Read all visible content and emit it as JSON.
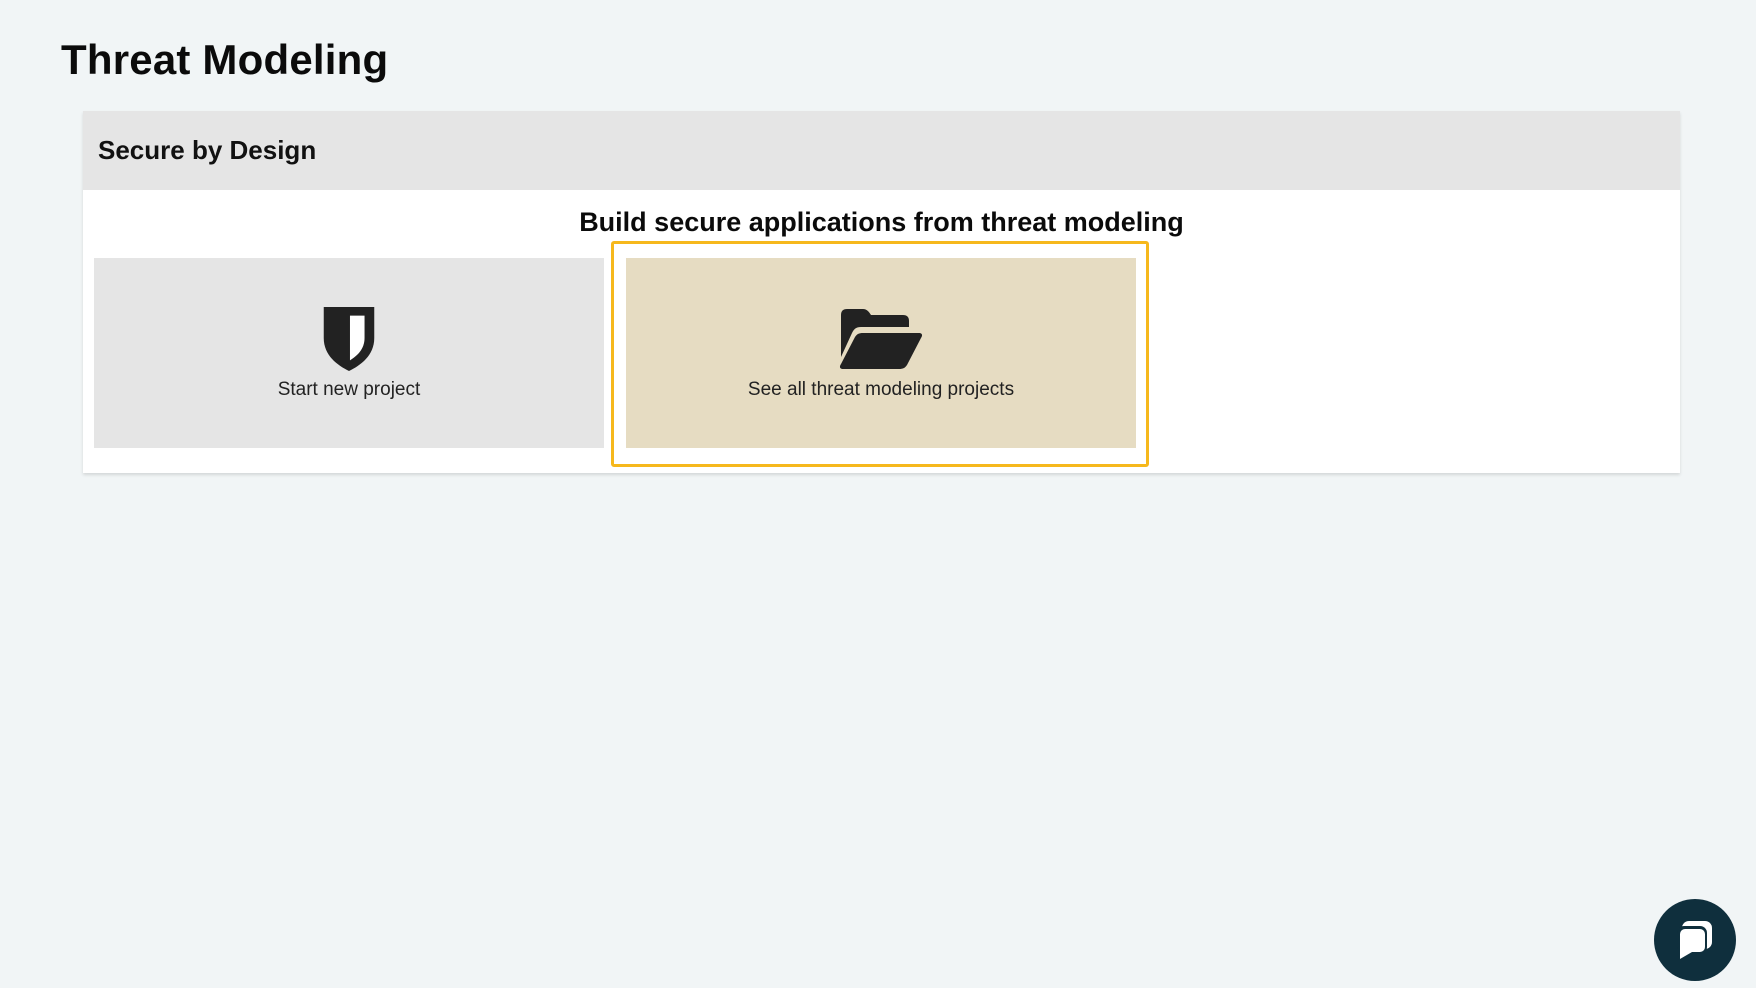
{
  "page": {
    "title": "Threat Modeling"
  },
  "panel": {
    "header_title": "Secure by Design",
    "subtitle": "Build secure applications from threat modeling",
    "cards": [
      {
        "label": "Start new project",
        "icon": "shield-icon"
      },
      {
        "label": "See all threat modeling projects",
        "icon": "folder-open-icon",
        "highlighted": true
      }
    ]
  },
  "chat": {
    "icon": "chat-bubble-icon"
  },
  "colors": {
    "background": "#f1f5f6",
    "card": "#e5e5e5",
    "card_highlight": "#e6dcc2",
    "focus_ring": "#f6b81c",
    "chat_button": "#0f2f3d"
  }
}
